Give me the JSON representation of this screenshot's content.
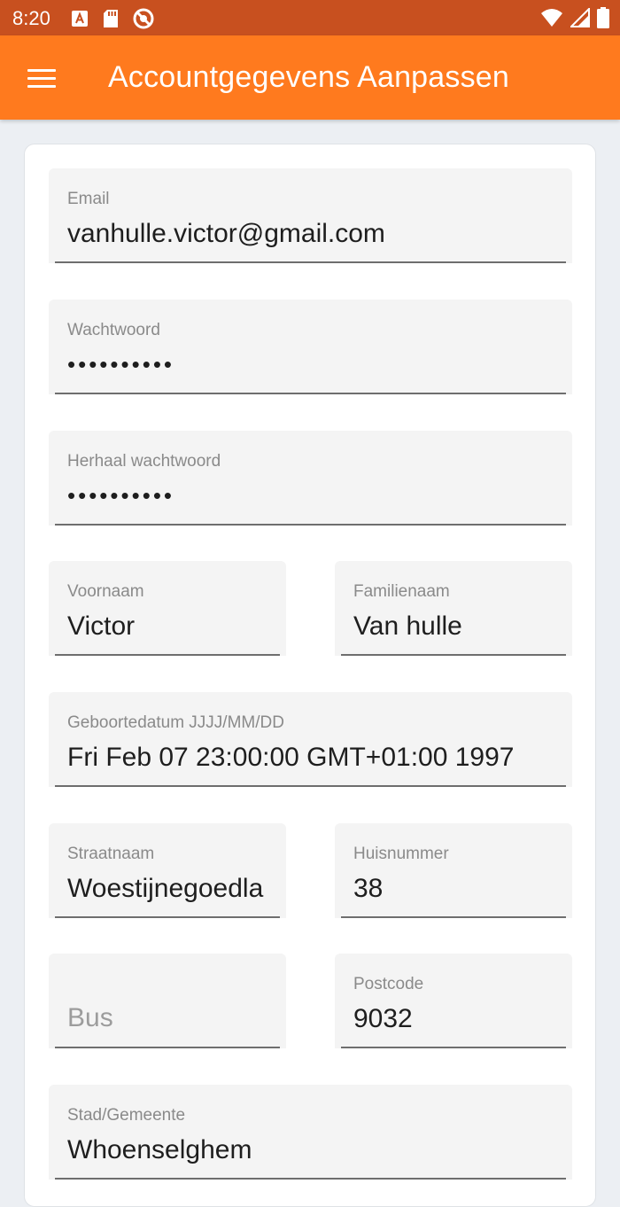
{
  "status_bar": {
    "time": "8:20",
    "left_icons": [
      "font-icon",
      "sd-card-icon",
      "no-sync-icon"
    ],
    "right_icons": [
      "wifi-icon",
      "signal-icon",
      "battery-icon"
    ],
    "background": "#C8501F"
  },
  "app_bar": {
    "title": "Accountgegevens Aanpassen",
    "background": "#FF7A1E",
    "menu_icon": "hamburger-menu-icon"
  },
  "form": {
    "email": {
      "label": "Email",
      "value": "vanhulle.victor@gmail.com"
    },
    "password": {
      "label": "Wachtwoord",
      "value": "••••••••••"
    },
    "repeat_password": {
      "label": "Herhaal wachtwoord",
      "value": "••••••••••"
    },
    "first_name": {
      "label": "Voornaam",
      "value": "Victor"
    },
    "last_name": {
      "label": "Familienaam",
      "value": "Van hulle"
    },
    "birthdate": {
      "label": "Geboortedatum JJJJ/MM/DD",
      "value": "Fri Feb 07 23:00:00 GMT+01:00 1997"
    },
    "street": {
      "label": "Straatnaam",
      "value": "Woestijnegoedla"
    },
    "house_number": {
      "label": "Huisnummer",
      "value": "38"
    },
    "bus": {
      "placeholder": "Bus"
    },
    "postcode": {
      "label": "Postcode",
      "value": "9032"
    },
    "city": {
      "label": "Stad/Gemeente",
      "value": "Whoenselghem"
    }
  }
}
